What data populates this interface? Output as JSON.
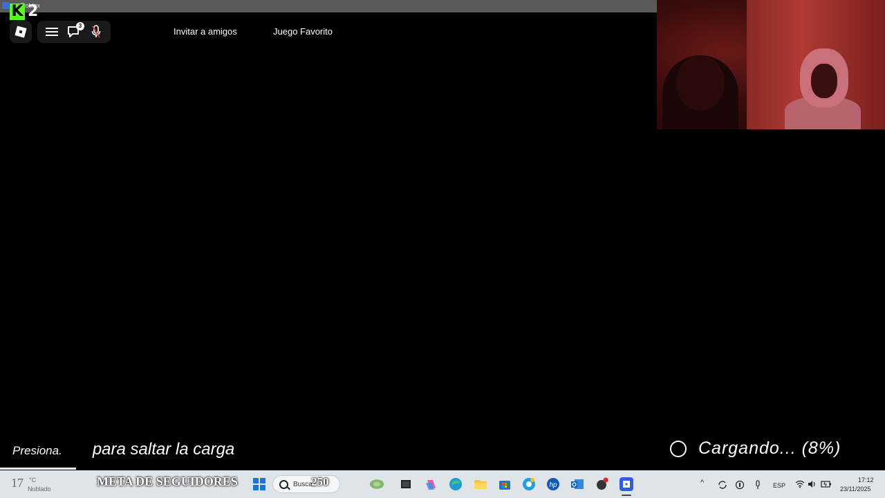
{
  "window": {
    "title": "Roblox"
  },
  "overlay": {
    "k2_logo_letter": "K",
    "k2_logo_number": "2",
    "k2_color": "#53fc18"
  },
  "roblox_top": {
    "chat_badge": "3",
    "links": [
      "Invitar a amigos",
      "Juego Favorito"
    ]
  },
  "loading_screen": {
    "press_text": "Presiona.",
    "skip_text": "para saltar la carga",
    "loading_text": "Cargando... (8%)",
    "progress_percent": 8
  },
  "stream_overlay": {
    "goal_label": "META DE SEGUIDORES",
    "goal_count": "250"
  },
  "taskbar": {
    "weather_temp": "17",
    "weather_unit": "°C",
    "weather_desc": "Nublado",
    "search_placeholder": "Busca",
    "apps": [
      "widgets-icon",
      "task-view-icon",
      "copilot-icon",
      "edge-icon",
      "file-explorer-icon",
      "store-icon",
      "chrome-icon",
      "hp-icon",
      "outlook-icon",
      "game-icon",
      "roblox-icon"
    ],
    "language": "ESP",
    "time": "17:12",
    "date": "23/11/2025"
  }
}
